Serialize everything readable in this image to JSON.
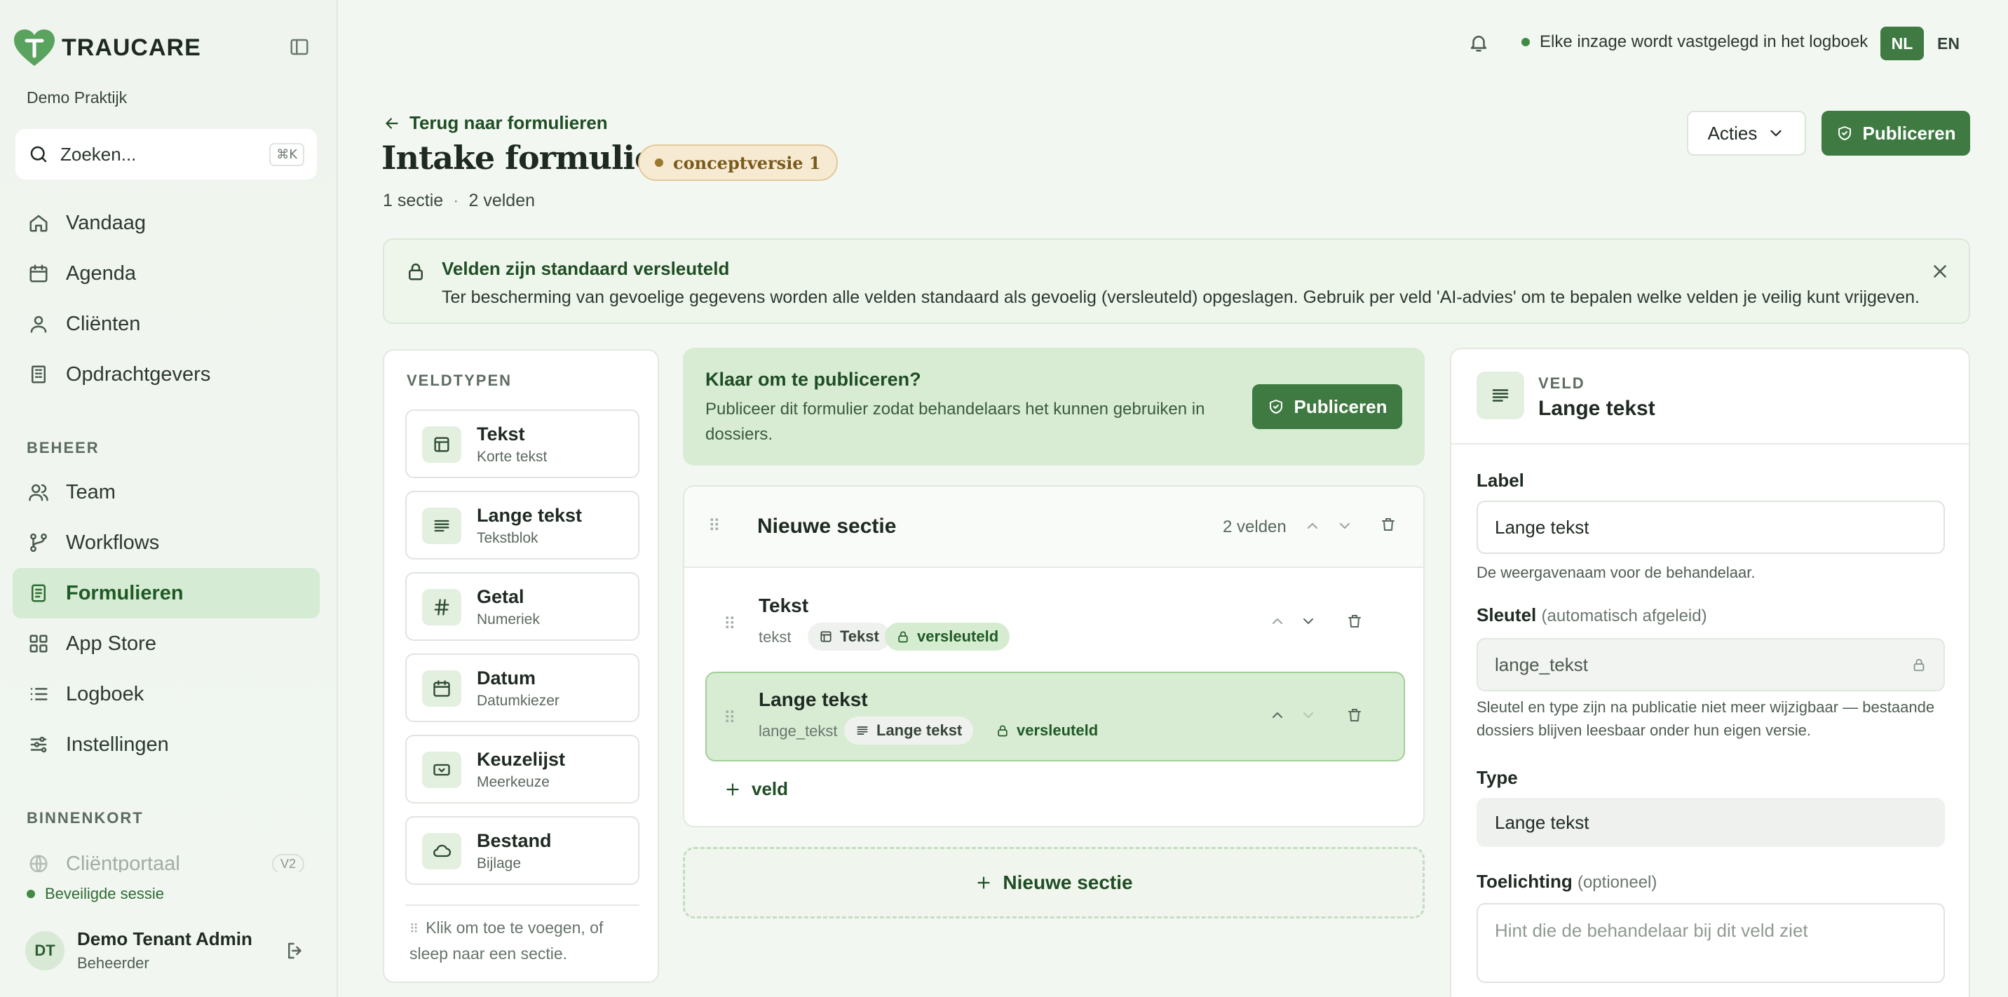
{
  "brand": {
    "name": "TRAUCARE"
  },
  "tenant": "Demo Praktijk",
  "search": {
    "placeholder": "Zoeken...",
    "shortcut": "⌘K"
  },
  "nav": {
    "main": [
      {
        "label": "Vandaag",
        "icon": "home-icon"
      },
      {
        "label": "Agenda",
        "icon": "calendar-icon"
      },
      {
        "label": "Cliënten",
        "icon": "user-icon"
      },
      {
        "label": "Opdrachtgevers",
        "icon": "building-icon"
      }
    ],
    "beheer_label": "BEHEER",
    "beheer": [
      {
        "label": "Team",
        "icon": "users-icon"
      },
      {
        "label": "Workflows",
        "icon": "workflow-icon"
      },
      {
        "label": "Formulieren",
        "icon": "form-icon",
        "active": true
      },
      {
        "label": "App Store",
        "icon": "grid-icon"
      },
      {
        "label": "Logboek",
        "icon": "list-icon"
      },
      {
        "label": "Instellingen",
        "icon": "sliders-icon"
      }
    ],
    "soon_label": "BINNENKORT",
    "soon": [
      {
        "label": "Cliëntportaal",
        "badge": "V2",
        "icon": "globe-icon"
      }
    ]
  },
  "session": {
    "label": "Beveiligde sessie"
  },
  "user": {
    "initials": "DT",
    "name": "Demo Tenant Admin",
    "role": "Beheerder"
  },
  "topbar": {
    "log_notice": "Elke inzage wordt vastgelegd in het logboek",
    "lang_nl": "NL",
    "lang_en": "EN"
  },
  "header": {
    "back": "Terug naar formulieren",
    "title": "Intake formulier",
    "badge": "conceptversie 1",
    "sections": "1 sectie",
    "fields": "2 velden",
    "sep": "·",
    "actions": "Acties",
    "publish": "Publiceren"
  },
  "notice": {
    "title": "Velden zijn standaard versleuteld",
    "text": "Ter bescherming van gevoelige gegevens worden alle velden standaard als gevoelig (versleuteld) opgeslagen. Gebruik per veld 'AI-advies' om te bepalen welke velden je veilig kunt vrijgeven."
  },
  "types": {
    "label": "VELDTYPEN",
    "items": [
      {
        "name": "Tekst",
        "sub": "Korte tekst",
        "icon": "text-field-icon"
      },
      {
        "name": "Lange tekst",
        "sub": "Tekstblok",
        "icon": "paragraph-icon"
      },
      {
        "name": "Getal",
        "sub": "Numeriek",
        "icon": "hash-icon"
      },
      {
        "name": "Datum",
        "sub": "Datumkiezer",
        "icon": "calendar-icon"
      },
      {
        "name": "Keuzelijst",
        "sub": "Meerkeuze",
        "icon": "select-icon"
      },
      {
        "name": "Bestand",
        "sub": "Bijlage",
        "icon": "cloud-icon"
      }
    ],
    "hint": "Klik om toe te voegen, of sleep naar een sectie."
  },
  "ready": {
    "title": "Klaar om te publiceren?",
    "text": "Publiceer dit formulier zodat behandelaars het kunnen gebruiken in dossiers.",
    "button": "Publiceren"
  },
  "section": {
    "title": "Nieuwe sectie",
    "count": "2 velden",
    "fields": [
      {
        "title": "Tekst",
        "key": "tekst",
        "type": "Tekst",
        "enc": "versleuteld"
      },
      {
        "title": "Lange tekst",
        "key": "lange_tekst",
        "type": "Lange tekst",
        "enc": "versleuteld"
      }
    ],
    "add_field": "veld",
    "new_section": "Nieuwe sectie"
  },
  "field_panel": {
    "kicker": "VELD",
    "title": "Lange tekst",
    "label_label": "Label",
    "label_value": "Lange tekst",
    "label_help": "De weergavenaam voor de behandelaar.",
    "key_label": "Sleutel",
    "key_note": "(automatisch afgeleid)",
    "key_value": "lange_tekst",
    "key_help": "Sleutel en type zijn na publicatie niet meer wijzigbaar — bestaande dossiers blijven leesbaar onder hun eigen versie.",
    "type_label": "Type",
    "type_value": "Lange tekst",
    "hint_label": "Toelichting",
    "hint_note": "(optioneel)",
    "hint_placeholder": "Hint die de behandelaar bij dit veld ziet"
  },
  "colors": {
    "accent": "#3e7a41",
    "accent_light": "#d8ecd4",
    "badge": "#f6ead2"
  }
}
